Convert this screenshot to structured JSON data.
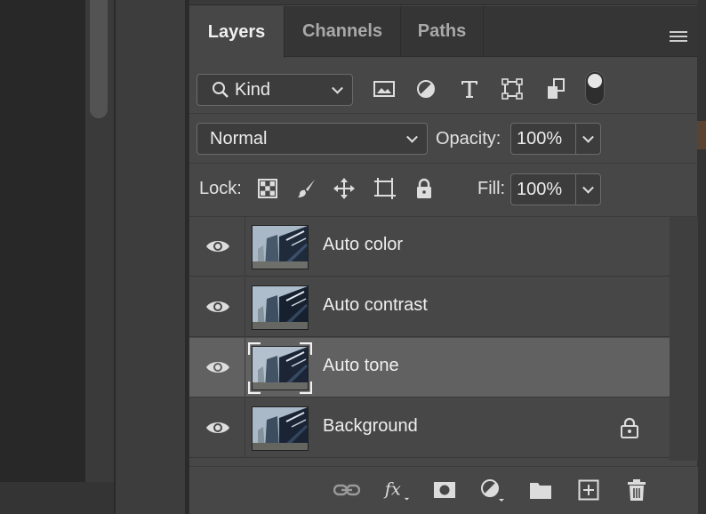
{
  "tabs": [
    {
      "label": "Layers",
      "active": true
    },
    {
      "label": "Channels",
      "active": false
    },
    {
      "label": "Paths",
      "active": false
    }
  ],
  "filter": {
    "kind_label": "Kind",
    "filter_icons": [
      "image-filter-icon",
      "adjustment-filter-icon",
      "type-filter-icon",
      "shape-filter-icon",
      "smart-object-filter-icon"
    ]
  },
  "blend": {
    "mode": "Normal",
    "opacity_label": "Opacity:",
    "opacity_value": "100%"
  },
  "lock": {
    "label": "Lock:",
    "icons": [
      "lock-transparent-pixels-icon",
      "lock-image-pixels-icon",
      "lock-position-icon",
      "lock-artboard-icon",
      "lock-all-icon"
    ],
    "fill_label": "Fill:",
    "fill_value": "100%"
  },
  "layers": [
    {
      "name": "Auto color",
      "visible": true,
      "selected": false,
      "locked": false
    },
    {
      "name": "Auto contrast",
      "visible": true,
      "selected": false,
      "locked": false
    },
    {
      "name": "Auto tone",
      "visible": true,
      "selected": true,
      "locked": false
    },
    {
      "name": "Background",
      "visible": true,
      "selected": false,
      "locked": true
    }
  ],
  "footer_icons": [
    "link-layers-icon",
    "fx-icon",
    "layer-mask-icon",
    "adjustment-layer-icon",
    "group-folder-icon",
    "new-layer-icon",
    "trash-icon"
  ],
  "colors": {
    "panel_bg": "#474747",
    "selected_layer": "#616161",
    "tab_bar": "#353535"
  }
}
